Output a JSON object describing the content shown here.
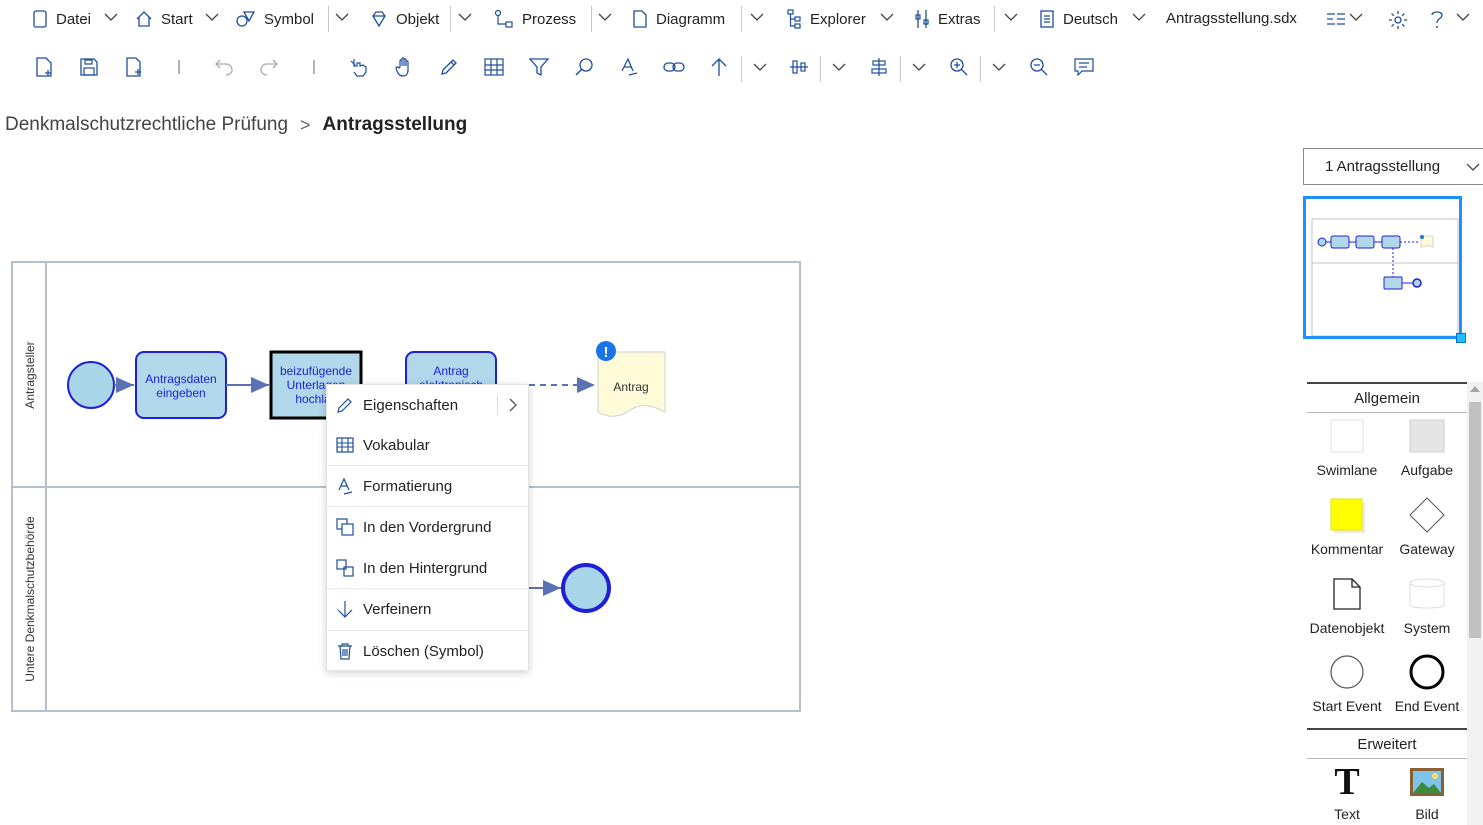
{
  "menubar": {
    "datei": "Datei",
    "start": "Start",
    "symbol": "Symbol",
    "objekt": "Objekt",
    "prozess": "Prozess",
    "diagramm": "Diagramm",
    "explorer": "Explorer",
    "extras": "Extras",
    "language": "Deutsch",
    "filename": "Antragsstellung.sdx"
  },
  "breadcrumb": {
    "parent": "Denkmalschutzrechtliche Prüfung",
    "separator": ">",
    "current": "Antragsstellung"
  },
  "diagram": {
    "lanes": [
      "Antragsteller",
      "Untere Denkmalschutzbehörde"
    ],
    "tasks": [
      "Antragsdaten eingeben",
      "beizufügende Unterlagen hochlac",
      "Antrag elektronisch"
    ],
    "data_object": "Antrag",
    "warning_symbol": "!",
    "colors": {
      "task_fill": "#b0d8ea",
      "task_border": "#1f1fd6",
      "event_fill": "#a8d5e8",
      "doc_fill": "#fffbd9"
    }
  },
  "context_menu": {
    "items": [
      "Eigenschaften",
      "Vokabular",
      "Formatierung",
      "In den Vordergrund",
      "In den Hintergrund",
      "Verfeinern",
      "Löschen (Symbol)"
    ]
  },
  "right_panel": {
    "page_select": "1 Antragsstellung",
    "palette": {
      "general_title": "Allgemein",
      "general_items": [
        "Swimlane",
        "Aufgabe",
        "Kommentar",
        "Gateway",
        "Datenobjekt",
        "System",
        "Start Event",
        "End Event"
      ],
      "extended_title": "Erweitert",
      "extended_items": [
        "Text",
        "Bild"
      ],
      "text_glyph": "T"
    }
  }
}
